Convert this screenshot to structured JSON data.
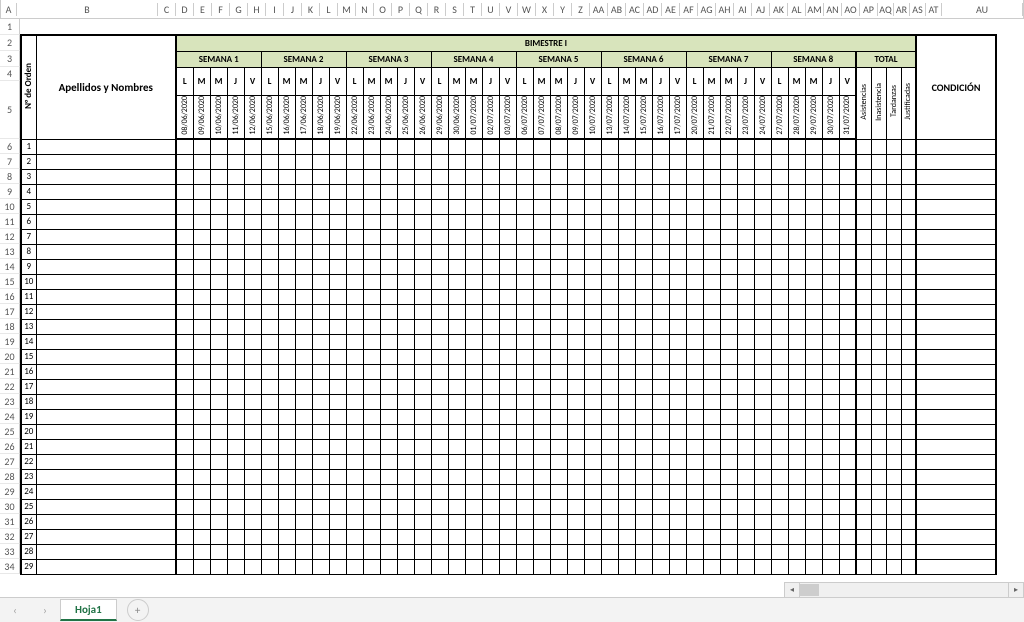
{
  "columns_letters": [
    "A",
    "B",
    "C",
    "D",
    "E",
    "F",
    "G",
    "H",
    "I",
    "J",
    "K",
    "L",
    "M",
    "N",
    "O",
    "P",
    "Q",
    "R",
    "S",
    "T",
    "U",
    "V",
    "W",
    "X",
    "Y",
    "Z",
    "AA",
    "AB",
    "AC",
    "AD",
    "AE",
    "AF",
    "AG",
    "AH",
    "AI",
    "AJ",
    "AK",
    "AL",
    "AM",
    "AN",
    "AO",
    "AP",
    "AQ",
    "AR",
    "AS",
    "AT",
    "AU"
  ],
  "row_numbers": [
    1,
    2,
    3,
    4,
    5,
    6,
    7,
    8,
    9,
    10,
    11,
    12,
    13,
    14,
    15,
    16,
    17,
    18,
    19,
    20,
    21,
    22,
    23,
    24,
    25,
    26,
    27,
    28,
    29,
    30,
    31,
    32,
    33,
    34
  ],
  "header": {
    "orden": "N° de Orden",
    "nombres": "Apellidos y Nombres",
    "bimestre": "BIMESTRE I",
    "condicion": "CONDICIÓN",
    "total": "TOTAL",
    "totals": [
      "Asistencias",
      "Inasistencia",
      "Tardanzas",
      "Justificadas"
    ],
    "day_labels": [
      "L",
      "M",
      "M",
      "J",
      "V"
    ],
    "weeks": [
      {
        "label": "SEMANA 1",
        "dates": [
          "08/06/2020",
          "09/06/2020",
          "10/06/2020",
          "11/06/2020",
          "12/06/2020"
        ]
      },
      {
        "label": "SEMANA 2",
        "dates": [
          "15/06/2020",
          "16/06/2020",
          "17/06/2020",
          "18/06/2020",
          "19/06/2020"
        ]
      },
      {
        "label": "SEMANA 3",
        "dates": [
          "22/06/2020",
          "23/06/2020",
          "24/06/2020",
          "25/06/2020",
          "26/06/2020"
        ]
      },
      {
        "label": "SEMANA 4",
        "dates": [
          "29/06/2020",
          "30/06/2020",
          "01/07/2020",
          "02/07/2020",
          "03/07/2020"
        ]
      },
      {
        "label": "SEMANA 5",
        "dates": [
          "06/07/2020",
          "07/07/2020",
          "08/07/2020",
          "09/07/2020",
          "10/07/2020"
        ]
      },
      {
        "label": "SEMANA 6",
        "dates": [
          "13/07/2020",
          "14/07/2020",
          "15/07/2020",
          "16/07/2020",
          "17/07/2020"
        ]
      },
      {
        "label": "SEMANA 7",
        "dates": [
          "20/07/2020",
          "21/07/2020",
          "22/07/2020",
          "23/07/2020",
          "24/07/2020"
        ]
      },
      {
        "label": "SEMANA 8",
        "dates": [
          "27/07/2020",
          "28/07/2020",
          "29/07/2020",
          "30/07/2020",
          "31/07/2020"
        ]
      }
    ]
  },
  "data_rows": [
    1,
    2,
    3,
    4,
    5,
    6,
    7,
    8,
    9,
    10,
    11,
    12,
    13,
    14,
    15,
    16,
    17,
    18,
    19,
    20,
    21,
    22,
    23,
    24,
    25,
    26,
    27,
    28,
    29
  ],
  "tabs": {
    "active": "Hoja1"
  },
  "nav": {
    "first": "◂",
    "prev": "‹",
    "next": "›",
    "last": "▸",
    "plus": "+"
  }
}
